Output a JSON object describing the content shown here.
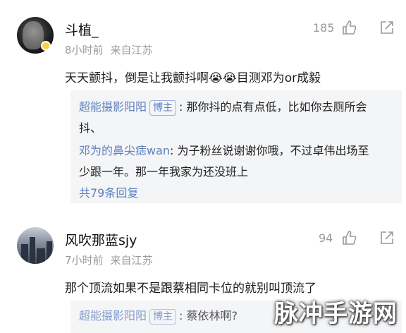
{
  "comments": [
    {
      "username": "斗植_",
      "time": "8小时前",
      "location": "来自江苏",
      "likes": "185",
      "text": "天天颤抖，倒是让我颤抖啊😭😭目测邓为or成毅",
      "replies": [
        {
          "name": "超能摄影阳阳",
          "tag": "博主",
          "text_line1": ": 那你抖的点有点低，比如你去厕所会",
          "text_line2": "抖、"
        },
        {
          "name": "邓为的鼻尖痣wan",
          "text_line1": ": 为子粉丝说谢谢你哦，不过卓伟出场至",
          "text_line2": "少跟一年。那一年我家为还没班上"
        }
      ],
      "more_replies": "共79条回复"
    },
    {
      "username": "风吹那蓝sjy",
      "time": "7小时前",
      "location": "来自江苏",
      "likes": "94",
      "text": "那个顶流如果不是跟蔡相同卡位的就别叫顶流了",
      "replies": [
        {
          "name": "超能摄影阳阳",
          "tag": "博主",
          "text_line1": ": 蔡依林啊?"
        }
      ]
    }
  ],
  "watermark": "脉冲手游网",
  "icons": {
    "like": "thumbs-up-icon",
    "share": "share-icon",
    "badge": "verified-badge-icon"
  },
  "colors": {
    "link": "#5b7fbf",
    "meta": "#9a9a9a",
    "reply_bg": "#f4f5f7"
  }
}
